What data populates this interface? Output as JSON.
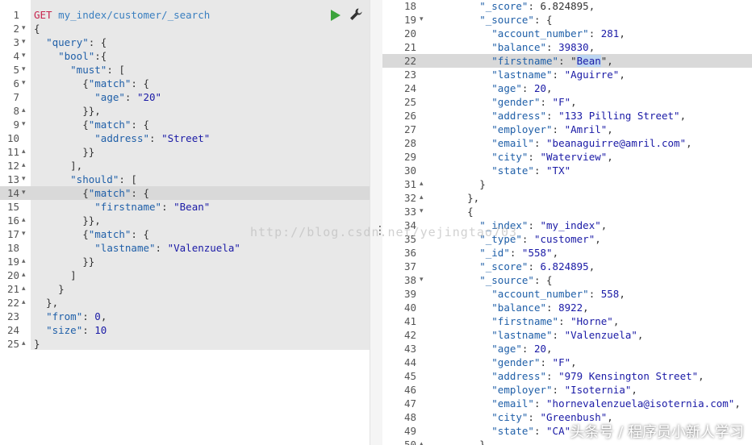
{
  "request": {
    "method": "GET",
    "url": "my_index/customer/_search",
    "lines": [
      {
        "n": "1",
        "fold": "",
        "t": []
      },
      {
        "n": "2",
        "fold": "▾",
        "t": [
          [
            "p",
            "{"
          ]
        ]
      },
      {
        "n": "3",
        "fold": "▾",
        "t": [
          [
            "p",
            "  "
          ],
          [
            "k",
            "\"query\""
          ],
          [
            "p",
            ": {"
          ]
        ]
      },
      {
        "n": "4",
        "fold": "▾",
        "t": [
          [
            "p",
            "    "
          ],
          [
            "k",
            "\"bool\""
          ],
          [
            "p",
            ":{"
          ]
        ]
      },
      {
        "n": "5",
        "fold": "▾",
        "t": [
          [
            "p",
            "      "
          ],
          [
            "k",
            "\"must\""
          ],
          [
            "p",
            ": ["
          ]
        ]
      },
      {
        "n": "6",
        "fold": "▾",
        "t": [
          [
            "p",
            "        {"
          ],
          [
            "k",
            "\"match\""
          ],
          [
            "p",
            ": {"
          ]
        ]
      },
      {
        "n": "7",
        "fold": "",
        "t": [
          [
            "p",
            "          "
          ],
          [
            "k",
            "\"age\""
          ],
          [
            "p",
            ": "
          ],
          [
            "s",
            "\"20\""
          ]
        ]
      },
      {
        "n": "8",
        "fold": "▴",
        "t": [
          [
            "p",
            "        }},"
          ]
        ]
      },
      {
        "n": "9",
        "fold": "▾",
        "t": [
          [
            "p",
            "        {"
          ],
          [
            "k",
            "\"match\""
          ],
          [
            "p",
            ": {"
          ]
        ]
      },
      {
        "n": "10",
        "fold": "",
        "t": [
          [
            "p",
            "          "
          ],
          [
            "k",
            "\"address\""
          ],
          [
            "p",
            ": "
          ],
          [
            "s",
            "\"Street\""
          ]
        ]
      },
      {
        "n": "11",
        "fold": "▴",
        "t": [
          [
            "p",
            "        }}"
          ]
        ]
      },
      {
        "n": "12",
        "fold": "▴",
        "t": [
          [
            "p",
            "      ],"
          ]
        ]
      },
      {
        "n": "13",
        "fold": "▾",
        "t": [
          [
            "p",
            "      "
          ],
          [
            "k",
            "\"should\""
          ],
          [
            "p",
            ": ["
          ]
        ]
      },
      {
        "n": "14",
        "fold": "▾",
        "t": [
          [
            "p",
            "        {"
          ],
          [
            "k",
            "\"match\""
          ],
          [
            "p",
            ": {"
          ]
        ],
        "hl": true
      },
      {
        "n": "15",
        "fold": "",
        "t": [
          [
            "p",
            "          "
          ],
          [
            "k",
            "\"firstname\""
          ],
          [
            "p",
            ": "
          ],
          [
            "s",
            "\"Bean\""
          ]
        ]
      },
      {
        "n": "16",
        "fold": "▴",
        "t": [
          [
            "p",
            "        }},"
          ]
        ]
      },
      {
        "n": "17",
        "fold": "▾",
        "t": [
          [
            "p",
            "        {"
          ],
          [
            "k",
            "\"match\""
          ],
          [
            "p",
            ": {"
          ]
        ]
      },
      {
        "n": "18",
        "fold": "",
        "t": [
          [
            "p",
            "          "
          ],
          [
            "k",
            "\"lastname\""
          ],
          [
            "p",
            ": "
          ],
          [
            "s",
            "\"Valenzuela\""
          ]
        ]
      },
      {
        "n": "19",
        "fold": "▴",
        "t": [
          [
            "p",
            "        }}"
          ]
        ]
      },
      {
        "n": "20",
        "fold": "▴",
        "t": [
          [
            "p",
            "      ]"
          ]
        ]
      },
      {
        "n": "21",
        "fold": "▴",
        "t": [
          [
            "p",
            "    }"
          ]
        ]
      },
      {
        "n": "22",
        "fold": "▴",
        "t": [
          [
            "p",
            "  },"
          ]
        ]
      },
      {
        "n": "23",
        "fold": "",
        "t": [
          [
            "p",
            "  "
          ],
          [
            "k",
            "\"from\""
          ],
          [
            "p",
            ": "
          ],
          [
            "n",
            "0"
          ],
          [
            "p",
            ","
          ]
        ]
      },
      {
        "n": "24",
        "fold": "",
        "t": [
          [
            "p",
            "  "
          ],
          [
            "k",
            "\"size\""
          ],
          [
            "p",
            ": "
          ],
          [
            "n",
            "10"
          ]
        ]
      },
      {
        "n": "25",
        "fold": "▴",
        "t": [
          [
            "p",
            "}"
          ]
        ]
      }
    ]
  },
  "response": {
    "lines": [
      {
        "n": "18",
        "fold": "",
        "t": [
          [
            "p",
            "        "
          ],
          [
            "k",
            "\"_score\""
          ],
          [
            "p",
            ": 6.824895,"
          ]
        ]
      },
      {
        "n": "19",
        "fold": "▾",
        "t": [
          [
            "p",
            "        "
          ],
          [
            "k",
            "\"_source\""
          ],
          [
            "p",
            ": {"
          ]
        ]
      },
      {
        "n": "20",
        "fold": "",
        "t": [
          [
            "p",
            "          "
          ],
          [
            "k",
            "\"account_number\""
          ],
          [
            "p",
            ": "
          ],
          [
            "n",
            "281"
          ],
          [
            "p",
            ","
          ]
        ]
      },
      {
        "n": "21",
        "fold": "",
        "t": [
          [
            "p",
            "          "
          ],
          [
            "k",
            "\"balance\""
          ],
          [
            "p",
            ": "
          ],
          [
            "n",
            "39830"
          ],
          [
            "p",
            ","
          ]
        ]
      },
      {
        "n": "22",
        "fold": "",
        "t": [
          [
            "p",
            "          "
          ],
          [
            "k",
            "\"firstname\""
          ],
          [
            "p",
            ": \""
          ],
          [
            "sel",
            "Bean"
          ],
          [
            "p",
            "\","
          ]
        ],
        "hl": true
      },
      {
        "n": "23",
        "fold": "",
        "t": [
          [
            "p",
            "          "
          ],
          [
            "k",
            "\"lastname\""
          ],
          [
            "p",
            ": "
          ],
          [
            "s",
            "\"Aguirre\""
          ],
          [
            "p",
            ","
          ]
        ]
      },
      {
        "n": "24",
        "fold": "",
        "t": [
          [
            "p",
            "          "
          ],
          [
            "k",
            "\"age\""
          ],
          [
            "p",
            ": "
          ],
          [
            "n",
            "20"
          ],
          [
            "p",
            ","
          ]
        ]
      },
      {
        "n": "25",
        "fold": "",
        "t": [
          [
            "p",
            "          "
          ],
          [
            "k",
            "\"gender\""
          ],
          [
            "p",
            ": "
          ],
          [
            "s",
            "\"F\""
          ],
          [
            "p",
            ","
          ]
        ]
      },
      {
        "n": "26",
        "fold": "",
        "t": [
          [
            "p",
            "          "
          ],
          [
            "k",
            "\"address\""
          ],
          [
            "p",
            ": "
          ],
          [
            "s",
            "\"133 Pilling Street\""
          ],
          [
            "p",
            ","
          ]
        ]
      },
      {
        "n": "27",
        "fold": "",
        "t": [
          [
            "p",
            "          "
          ],
          [
            "k",
            "\"employer\""
          ],
          [
            "p",
            ": "
          ],
          [
            "s",
            "\"Amril\""
          ],
          [
            "p",
            ","
          ]
        ]
      },
      {
        "n": "28",
        "fold": "",
        "t": [
          [
            "p",
            "          "
          ],
          [
            "k",
            "\"email\""
          ],
          [
            "p",
            ": "
          ],
          [
            "s",
            "\"beanaguirre@amril.com\""
          ],
          [
            "p",
            ","
          ]
        ]
      },
      {
        "n": "29",
        "fold": "",
        "t": [
          [
            "p",
            "          "
          ],
          [
            "k",
            "\"city\""
          ],
          [
            "p",
            ": "
          ],
          [
            "s",
            "\"Waterview\""
          ],
          [
            "p",
            ","
          ]
        ]
      },
      {
        "n": "30",
        "fold": "",
        "t": [
          [
            "p",
            "          "
          ],
          [
            "k",
            "\"state\""
          ],
          [
            "p",
            ": "
          ],
          [
            "s",
            "\"TX\""
          ]
        ]
      },
      {
        "n": "31",
        "fold": "▴",
        "t": [
          [
            "p",
            "        }"
          ]
        ]
      },
      {
        "n": "32",
        "fold": "▴",
        "t": [
          [
            "p",
            "      },"
          ]
        ]
      },
      {
        "n": "33",
        "fold": "▾",
        "t": [
          [
            "p",
            "      {"
          ]
        ]
      },
      {
        "n": "34",
        "fold": "",
        "t": [
          [
            "p",
            "        "
          ],
          [
            "k",
            "\"_index\""
          ],
          [
            "p",
            ": "
          ],
          [
            "s",
            "\"my_index\""
          ],
          [
            "p",
            ","
          ]
        ]
      },
      {
        "n": "35",
        "fold": "",
        "t": [
          [
            "p",
            "        "
          ],
          [
            "k",
            "\"_type\""
          ],
          [
            "p",
            ": "
          ],
          [
            "s",
            "\"customer\""
          ],
          [
            "p",
            ","
          ]
        ]
      },
      {
        "n": "36",
        "fold": "",
        "t": [
          [
            "p",
            "        "
          ],
          [
            "k",
            "\"_id\""
          ],
          [
            "p",
            ": "
          ],
          [
            "s",
            "\"558\""
          ],
          [
            "p",
            ","
          ]
        ]
      },
      {
        "n": "37",
        "fold": "",
        "t": [
          [
            "p",
            "        "
          ],
          [
            "k",
            "\"_score\""
          ],
          [
            "p",
            ": "
          ],
          [
            "n",
            "6.824895"
          ],
          [
            "p",
            ","
          ]
        ]
      },
      {
        "n": "38",
        "fold": "▾",
        "t": [
          [
            "p",
            "        "
          ],
          [
            "k",
            "\"_source\""
          ],
          [
            "p",
            ": {"
          ]
        ]
      },
      {
        "n": "39",
        "fold": "",
        "t": [
          [
            "p",
            "          "
          ],
          [
            "k",
            "\"account_number\""
          ],
          [
            "p",
            ": "
          ],
          [
            "n",
            "558"
          ],
          [
            "p",
            ","
          ]
        ]
      },
      {
        "n": "40",
        "fold": "",
        "t": [
          [
            "p",
            "          "
          ],
          [
            "k",
            "\"balance\""
          ],
          [
            "p",
            ": "
          ],
          [
            "n",
            "8922"
          ],
          [
            "p",
            ","
          ]
        ]
      },
      {
        "n": "41",
        "fold": "",
        "t": [
          [
            "p",
            "          "
          ],
          [
            "k",
            "\"firstname\""
          ],
          [
            "p",
            ": "
          ],
          [
            "s",
            "\"Horne\""
          ],
          [
            "p",
            ","
          ]
        ]
      },
      {
        "n": "42",
        "fold": "",
        "t": [
          [
            "p",
            "          "
          ],
          [
            "k",
            "\"lastname\""
          ],
          [
            "p",
            ": "
          ],
          [
            "s",
            "\"Valenzuela\""
          ],
          [
            "p",
            ","
          ]
        ]
      },
      {
        "n": "43",
        "fold": "",
        "t": [
          [
            "p",
            "          "
          ],
          [
            "k",
            "\"age\""
          ],
          [
            "p",
            ": "
          ],
          [
            "n",
            "20"
          ],
          [
            "p",
            ","
          ]
        ]
      },
      {
        "n": "44",
        "fold": "",
        "t": [
          [
            "p",
            "          "
          ],
          [
            "k",
            "\"gender\""
          ],
          [
            "p",
            ": "
          ],
          [
            "s",
            "\"F\""
          ],
          [
            "p",
            ","
          ]
        ]
      },
      {
        "n": "45",
        "fold": "",
        "t": [
          [
            "p",
            "          "
          ],
          [
            "k",
            "\"address\""
          ],
          [
            "p",
            ": "
          ],
          [
            "s",
            "\"979 Kensington Street\""
          ],
          [
            "p",
            ","
          ]
        ]
      },
      {
        "n": "46",
        "fold": "",
        "t": [
          [
            "p",
            "          "
          ],
          [
            "k",
            "\"employer\""
          ],
          [
            "p",
            ": "
          ],
          [
            "s",
            "\"Isoternia\""
          ],
          [
            "p",
            ","
          ]
        ]
      },
      {
        "n": "47",
        "fold": "",
        "t": [
          [
            "p",
            "          "
          ],
          [
            "k",
            "\"email\""
          ],
          [
            "p",
            ": "
          ],
          [
            "s",
            "\"hornevalenzuela@isoternia.com\""
          ],
          [
            "p",
            ","
          ]
        ]
      },
      {
        "n": "48",
        "fold": "",
        "t": [
          [
            "p",
            "          "
          ],
          [
            "k",
            "\"city\""
          ],
          [
            "p",
            ": "
          ],
          [
            "s",
            "\"Greenbush\""
          ],
          [
            "p",
            ","
          ]
        ]
      },
      {
        "n": "49",
        "fold": "",
        "t": [
          [
            "p",
            "          "
          ],
          [
            "k",
            "\"state\""
          ],
          [
            "p",
            ": "
          ],
          [
            "s",
            "\"CA\""
          ]
        ]
      },
      {
        "n": "50",
        "fold": "▴",
        "t": [
          [
            "p",
            "        }"
          ]
        ]
      }
    ]
  },
  "watermark": "http://blog.csdn.net/yejingtao703",
  "badge": "头条号 / 程序员小新人学习",
  "icons": {
    "run": "play-icon",
    "settings": "wrench-icon",
    "grip": "vertical-ellipsis-icon"
  },
  "colors": {
    "run": "#3ca33c",
    "key": "#1f5fa8",
    "method": "#c7254e"
  }
}
